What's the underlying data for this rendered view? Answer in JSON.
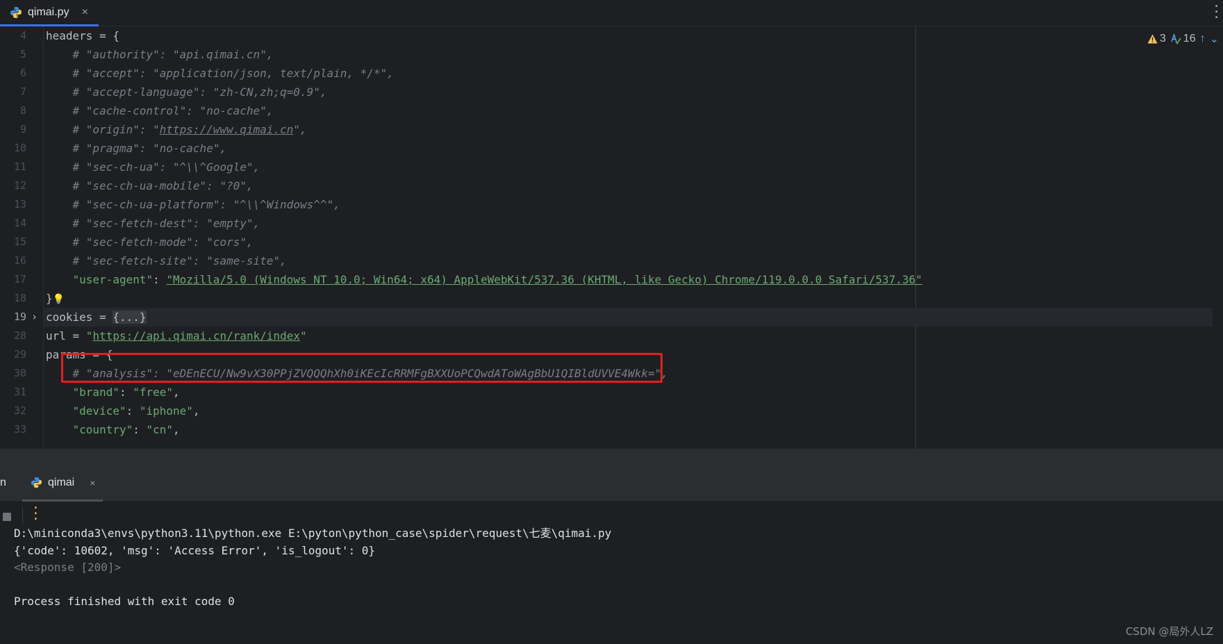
{
  "editor_tab": {
    "label": "qimai.py",
    "close": "×"
  },
  "inspections": {
    "warnings": "3",
    "typos": "16",
    "up": "↑",
    "down": "⌄"
  },
  "editor": {
    "lines": [
      {
        "num": "4",
        "parts": [
          {
            "t": "headers = {",
            "c": ""
          }
        ]
      },
      {
        "num": "5",
        "parts": [
          {
            "t": "    # \"authority\": \"api.qimai.cn\",",
            "c": "cmt"
          }
        ]
      },
      {
        "num": "6",
        "parts": [
          {
            "t": "    # \"accept\": \"application/json, text/plain, */*\",",
            "c": "cmt"
          }
        ]
      },
      {
        "num": "7",
        "parts": [
          {
            "t": "    # \"accept-language\": \"zh-CN,zh;q=0.9\",",
            "c": "cmt"
          }
        ]
      },
      {
        "num": "8",
        "parts": [
          {
            "t": "    # \"cache-control\": \"no-cache\",",
            "c": "cmt"
          }
        ]
      },
      {
        "num": "9",
        "parts": [
          {
            "t": "    # \"origin\": \"",
            "c": "cmt"
          },
          {
            "t": "https://www.qimai.cn",
            "c": "cmt link"
          },
          {
            "t": "\",",
            "c": "cmt"
          }
        ]
      },
      {
        "num": "10",
        "parts": [
          {
            "t": "    # \"pragma\": \"no-cache\",",
            "c": "cmt"
          }
        ]
      },
      {
        "num": "11",
        "parts": [
          {
            "t": "    # \"sec-ch-ua\": \"^\\\\^Google\",",
            "c": "cmt"
          }
        ]
      },
      {
        "num": "12",
        "parts": [
          {
            "t": "    # \"sec-ch-ua-mobile\": \"?0\",",
            "c": "cmt"
          }
        ]
      },
      {
        "num": "13",
        "parts": [
          {
            "t": "    # \"sec-ch-ua-platform\": \"^\\\\^Windows^^\",",
            "c": "cmt"
          }
        ]
      },
      {
        "num": "14",
        "parts": [
          {
            "t": "    # \"sec-fetch-dest\": \"empty\",",
            "c": "cmt"
          }
        ]
      },
      {
        "num": "15",
        "parts": [
          {
            "t": "    # \"sec-fetch-mode\": \"cors\",",
            "c": "cmt"
          }
        ]
      },
      {
        "num": "16",
        "parts": [
          {
            "t": "    # \"sec-fetch-site\": \"same-site\",",
            "c": "cmt"
          }
        ]
      },
      {
        "num": "17",
        "parts": [
          {
            "t": "    ",
            "c": ""
          },
          {
            "t": "\"user-agent\"",
            "c": "key"
          },
          {
            "t": ": ",
            "c": ""
          },
          {
            "t": "\"Mozilla/5.0 (Windows NT 10.0; Win64; x64) AppleWebKit/537.36 (KHTML, like Gecko) Chrome/119.0.0.0 Safari/537.36\"",
            "c": "str link"
          }
        ]
      },
      {
        "num": "18",
        "parts": [
          {
            "t": "}",
            "c": ""
          },
          {
            "t": "💡",
            "c": "bulb"
          }
        ]
      },
      {
        "num": "19",
        "current": true,
        "fold": "›",
        "parts": [
          {
            "t": "cookies = ",
            "c": ""
          },
          {
            "t": "{...}",
            "c": "fold-box"
          }
        ]
      },
      {
        "num": "28",
        "parts": [
          {
            "t": "url = ",
            "c": ""
          },
          {
            "t": "\"",
            "c": "str"
          },
          {
            "t": "https://api.qimai.cn/rank/index",
            "c": "str link"
          },
          {
            "t": "\"",
            "c": "str"
          }
        ]
      },
      {
        "num": "29",
        "parts": [
          {
            "t": "params = {",
            "c": ""
          }
        ]
      },
      {
        "num": "30",
        "parts": [
          {
            "t": "    # \"analysis\": \"eDEnECU/Nw9vX30PPjZVQQQhXh0iKEcIcRRMFgBXXUoPCQwdAToWAgBbU1QIBldUVVE4Wkk=\",",
            "c": "cmt"
          }
        ]
      },
      {
        "num": "31",
        "parts": [
          {
            "t": "    ",
            "c": ""
          },
          {
            "t": "\"brand\"",
            "c": "key"
          },
          {
            "t": ": ",
            "c": ""
          },
          {
            "t": "\"free\"",
            "c": "str"
          },
          {
            "t": ",",
            "c": ""
          }
        ]
      },
      {
        "num": "32",
        "parts": [
          {
            "t": "    ",
            "c": ""
          },
          {
            "t": "\"device\"",
            "c": "key"
          },
          {
            "t": ": ",
            "c": ""
          },
          {
            "t": "\"iphone\"",
            "c": "str"
          },
          {
            "t": ",",
            "c": ""
          }
        ]
      },
      {
        "num": "33",
        "parts": [
          {
            "t": "    ",
            "c": ""
          },
          {
            "t": "\"country\"",
            "c": "key"
          },
          {
            "t": ": ",
            "c": ""
          },
          {
            "t": "\"cn\"",
            "c": "str"
          },
          {
            "t": ",",
            "c": ""
          }
        ]
      }
    ]
  },
  "tool_window": {
    "left_label": "n",
    "run_tab": {
      "label": "qimai",
      "close": "×"
    },
    "output": [
      {
        "text": "D:\\miniconda3\\envs\\python3.11\\python.exe E:\\pyton\\python_case\\spider\\request\\七麦\\qimai.py",
        "c": ""
      },
      {
        "text": "{'code': 10602, 'msg': 'Access Error', 'is_logout': 0}",
        "c": ""
      },
      {
        "text": "<Response [200]>",
        "c": "dim"
      },
      {
        "text": "",
        "c": ""
      },
      {
        "text": "Process finished with exit code 0",
        "c": ""
      }
    ]
  },
  "watermark": "CSDN @局外人LZ",
  "colors": {
    "accent": "#3574f0",
    "highlight_box": "#e02020",
    "string": "#6aab73",
    "comment": "#7a7e85"
  }
}
